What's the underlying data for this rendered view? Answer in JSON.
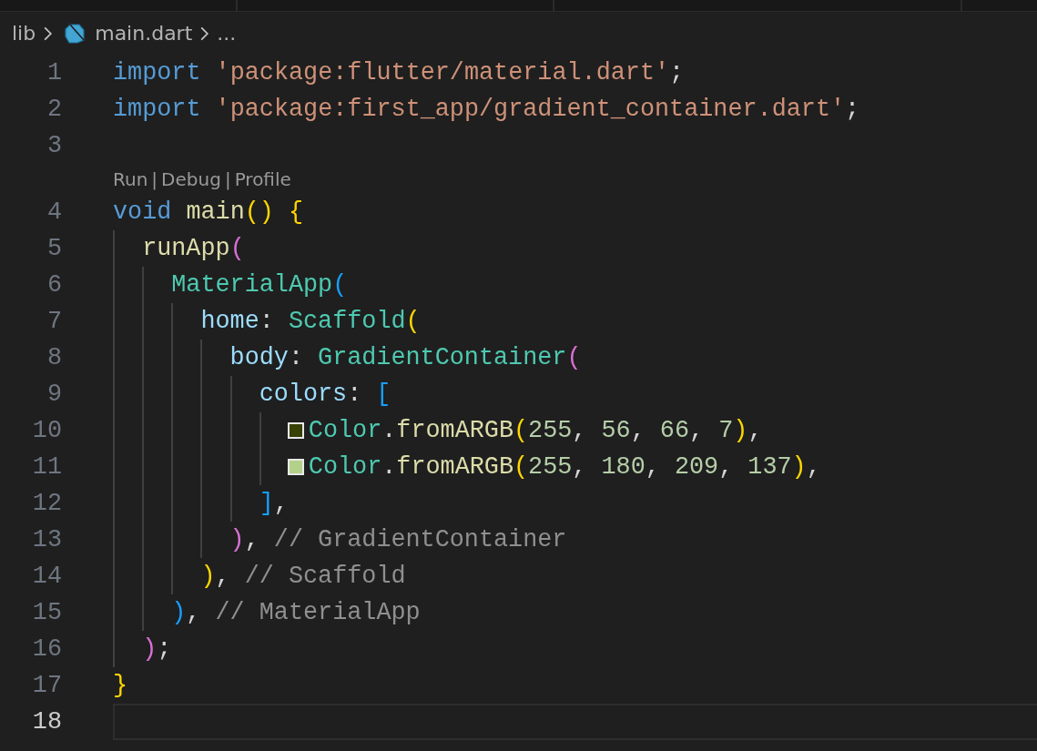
{
  "breadcrumb": {
    "items": [
      {
        "label": "lib",
        "kind": "folder"
      },
      {
        "label": "main.dart",
        "kind": "file"
      },
      {
        "label": "...",
        "kind": "more"
      }
    ]
  },
  "lines": [
    {
      "number": "1",
      "current": false,
      "tokens": [
        {
          "kind": "keyword",
          "text": "import"
        },
        {
          "kind": "string",
          "text": " 'package:flutter/material.dart'"
        },
        {
          "kind": "plain",
          "text": ";"
        }
      ]
    },
    {
      "number": "2",
      "current": false,
      "tokens": [
        {
          "kind": "keyword",
          "text": "import"
        },
        {
          "kind": "string",
          "text": " 'package:first_app/gradient_container.dart'"
        },
        {
          "kind": "plain",
          "text": ";"
        }
      ]
    },
    {
      "number": "3",
      "current": false
    },
    {
      "number": "4",
      "current": false,
      "code_lens": {
        "items": [
          "Run",
          "Debug",
          "Profile"
        ],
        "separators": [
          "|",
          "|"
        ]
      },
      "tokens": [
        {
          "kind": "keyword",
          "text": "void"
        },
        {
          "kind": "function",
          "text": " main"
        },
        {
          "kind": "bracket1",
          "text": "()"
        },
        {
          "kind": "bracket1",
          "text": " {"
        }
      ],
      "children": [
        {
          "number": "5",
          "current": false,
          "tokens": [
            {
              "kind": "function",
              "text": "runApp"
            },
            {
              "kind": "bracket2",
              "text": "("
            }
          ],
          "children": [
            {
              "number": "6",
              "current": false,
              "tokens": [
                {
                  "kind": "class",
                  "text": "MaterialApp"
                },
                {
                  "kind": "bracket3",
                  "text": "("
                }
              ],
              "children": [
                {
                  "number": "7",
                  "current": false,
                  "tokens": [
                    {
                      "kind": "property",
                      "text": "home"
                    },
                    {
                      "kind": "plain",
                      "text": ":"
                    },
                    {
                      "kind": "class",
                      "text": " Scaffold"
                    },
                    {
                      "kind": "bracket1",
                      "text": "("
                    }
                  ],
                  "children": [
                    {
                      "number": "8",
                      "current": false,
                      "tokens": [
                        {
                          "kind": "property",
                          "text": "body"
                        },
                        {
                          "kind": "plain",
                          "text": ":"
                        },
                        {
                          "kind": "class",
                          "text": " GradientContainer"
                        },
                        {
                          "kind": "bracket2",
                          "text": "("
                        }
                      ],
                      "children": [
                        {
                          "number": "9",
                          "current": false,
                          "tokens": [
                            {
                              "kind": "property",
                              "text": "colors"
                            },
                            {
                              "kind": "plain",
                              "text": ":"
                            },
                            {
                              "kind": "bracket3",
                              "text": " ["
                            }
                          ],
                          "children": [
                            {
                              "number": "10",
                              "current": false,
                              "tokens": [
                                {
                                  "kind": "swatch",
                                  "color": "#384207"
                                },
                                {
                                  "kind": "class",
                                  "text": "Color"
                                },
                                {
                                  "kind": "plain",
                                  "text": "."
                                },
                                {
                                  "kind": "function",
                                  "text": "fromARGB"
                                },
                                {
                                  "kind": "bracket1",
                                  "text": "("
                                },
                                {
                                  "kind": "number",
                                  "text": "255"
                                },
                                {
                                  "kind": "plain",
                                  "text": ","
                                },
                                {
                                  "kind": "number",
                                  "text": " 56"
                                },
                                {
                                  "kind": "plain",
                                  "text": ","
                                },
                                {
                                  "kind": "number",
                                  "text": " 66"
                                },
                                {
                                  "kind": "plain",
                                  "text": ","
                                },
                                {
                                  "kind": "number",
                                  "text": " 7"
                                },
                                {
                                  "kind": "bracket1",
                                  "text": ")"
                                },
                                {
                                  "kind": "plain",
                                  "text": ","
                                }
                              ]
                            },
                            {
                              "number": "11",
                              "current": false,
                              "tokens": [
                                {
                                  "kind": "swatch",
                                  "color": "#b4d189"
                                },
                                {
                                  "kind": "class",
                                  "text": "Color"
                                },
                                {
                                  "kind": "plain",
                                  "text": "."
                                },
                                {
                                  "kind": "function",
                                  "text": "fromARGB"
                                },
                                {
                                  "kind": "bracket1",
                                  "text": "("
                                },
                                {
                                  "kind": "number",
                                  "text": "255"
                                },
                                {
                                  "kind": "plain",
                                  "text": ","
                                },
                                {
                                  "kind": "number",
                                  "text": " 180"
                                },
                                {
                                  "kind": "plain",
                                  "text": ","
                                },
                                {
                                  "kind": "number",
                                  "text": " 209"
                                },
                                {
                                  "kind": "plain",
                                  "text": ","
                                },
                                {
                                  "kind": "number",
                                  "text": " 137"
                                },
                                {
                                  "kind": "bracket1",
                                  "text": ")"
                                },
                                {
                                  "kind": "plain",
                                  "text": ","
                                }
                              ]
                            }
                          ]
                        },
                        {
                          "number": "12",
                          "current": false,
                          "tokens": [
                            {
                              "kind": "bracket3",
                              "text": "]"
                            },
                            {
                              "kind": "plain",
                              "text": ","
                            }
                          ]
                        }
                      ]
                    },
                    {
                      "number": "13",
                      "current": false,
                      "tokens": [
                        {
                          "kind": "bracket2",
                          "text": ")"
                        },
                        {
                          "kind": "plain",
                          "text": ","
                        },
                        {
                          "kind": "label",
                          "text": " // GradientContainer"
                        }
                      ]
                    }
                  ]
                },
                {
                  "number": "14",
                  "current": false,
                  "tokens": [
                    {
                      "kind": "bracket1",
                      "text": ")"
                    },
                    {
                      "kind": "plain",
                      "text": ","
                    },
                    {
                      "kind": "label",
                      "text": " // Scaffold"
                    }
                  ]
                }
              ]
            },
            {
              "number": "15",
              "current": false,
              "tokens": [
                {
                  "kind": "bracket3",
                  "text": ")"
                },
                {
                  "kind": "plain",
                  "text": ","
                },
                {
                  "kind": "label",
                  "text": " // MaterialApp"
                }
              ]
            }
          ]
        },
        {
          "number": "16",
          "current": false,
          "tokens": [
            {
              "kind": "bracket2",
              "text": ")"
            },
            {
              "kind": "plain",
              "text": ";"
            }
          ]
        }
      ]
    },
    {
      "number": "17",
      "current": false,
      "tokens": [
        {
          "kind": "bracket1",
          "text": "}"
        }
      ]
    },
    {
      "number": "18",
      "current": true
    }
  ]
}
